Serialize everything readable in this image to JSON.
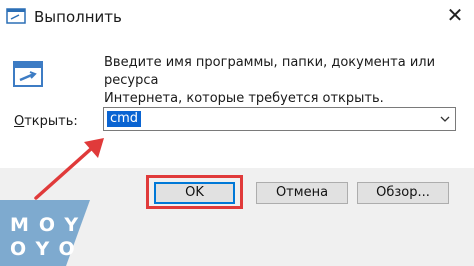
{
  "window": {
    "title": "Выполнить",
    "close_glyph": "✕"
  },
  "dialog": {
    "description_line1": "Введите имя программы, папки, документа или ресурса",
    "description_line2": "Интернета, которые требуется открыть.",
    "open_label": "Открыть:",
    "open_label_accel": "О",
    "open_label_rest": "ткрыть:",
    "input_value": "cmd"
  },
  "buttons": {
    "ok": "OK",
    "cancel": "Отмена",
    "browse": "Обзор..."
  },
  "watermark": {
    "row1": "MOY",
    "row2": "OYO"
  },
  "icons": {
    "title": "run-window-icon",
    "app": "run-dialog-app-icon",
    "dropdown": "chevron-down-icon"
  },
  "colors": {
    "highlight": "#e03a3a",
    "selection": "#0a64d2",
    "focus_border": "#0078d7",
    "footer_bg": "#f0f0f0"
  }
}
